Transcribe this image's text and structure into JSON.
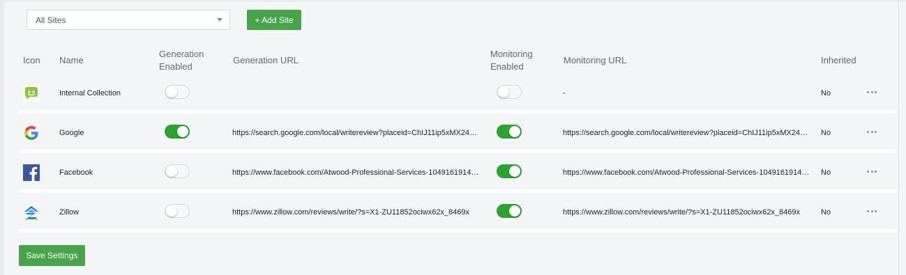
{
  "toolbar": {
    "site_select_value": "All Sites",
    "add_site_label": "+ Add Site"
  },
  "table": {
    "headers": {
      "icon": "Icon",
      "name": "Name",
      "generation_enabled_1": "Generation",
      "generation_enabled_2": "Enabled",
      "generation_url": "Generation URL",
      "monitoring_enabled_1": "Monitoring",
      "monitoring_enabled_2": "Enabled",
      "monitoring_url": "Monitoring URL",
      "inherited": "Inherited"
    },
    "rows": [
      {
        "icon": "internal-collection-icon",
        "name": "Internal Collection",
        "generation_enabled": false,
        "generation_url": "",
        "monitoring_enabled": false,
        "monitoring_url": "-",
        "inherited": "No"
      },
      {
        "icon": "google-icon",
        "name": "Google",
        "generation_enabled": true,
        "generation_url": "https://search.google.com/local/writereview?placeid=ChIJ11ip5xMX24…",
        "monitoring_enabled": true,
        "monitoring_url": "https://search.google.com/local/writereview?placeid=ChIJ11ip5xMX24…",
        "inherited": "No"
      },
      {
        "icon": "facebook-icon",
        "name": "Facebook",
        "generation_enabled": false,
        "generation_url": "https://www.facebook.com/Atwood-Professional-Services-1049161914…",
        "monitoring_enabled": true,
        "monitoring_url": "https://www.facebook.com/Atwood-Professional-Services-1049161914…",
        "inherited": "No"
      },
      {
        "icon": "zillow-icon",
        "name": "Zillow",
        "generation_enabled": false,
        "generation_url": "https://www.zillow.com/reviews/write/?s=X1-ZU11852ociwx62x_8469x",
        "monitoring_enabled": true,
        "monitoring_url": "https://www.zillow.com/reviews/write/?s=X1-ZU11852ociwx62x_8469x",
        "inherited": "No"
      }
    ]
  },
  "footer": {
    "save_label": "Save Settings"
  },
  "colors": {
    "accent_green": "#48a448",
    "toggle_on": "#2aa330"
  }
}
